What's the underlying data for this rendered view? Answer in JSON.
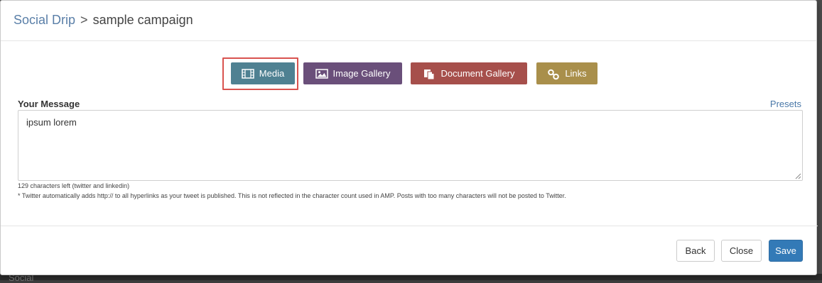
{
  "header": {
    "breadcrumb_root": "Social Drip",
    "breadcrumb_separator": ">",
    "breadcrumb_current": "sample campaign"
  },
  "toolbar": {
    "media_label": "Media",
    "image_gallery_label": "Image Gallery",
    "document_gallery_label": "Document Gallery",
    "links_label": "Links",
    "media_icon": "film-icon",
    "image_gallery_icon": "image-icon",
    "document_gallery_icon": "documents-icon",
    "links_icon": "link-icon",
    "colors": {
      "media": "#4f8192",
      "image_gallery": "#6a4f7a",
      "document_gallery": "#a64f4b",
      "links": "#a98f4b",
      "highlight": "#d9534f"
    }
  },
  "message": {
    "label": "Your Message",
    "presets_link": "Presets",
    "value": "ipsum lorem",
    "chars_left": "129 characters left (twitter and linkedin)",
    "note": "* Twitter automatically adds http:// to all hyperlinks as your tweet is published. This is not reflected in the character count used in AMP. Posts with too many characters will not be posted to Twitter."
  },
  "footer": {
    "back_label": "Back",
    "close_label": "Close",
    "save_label": "Save",
    "save_color": "#337ab7"
  },
  "backdrop": {
    "partial_text": "Social"
  }
}
